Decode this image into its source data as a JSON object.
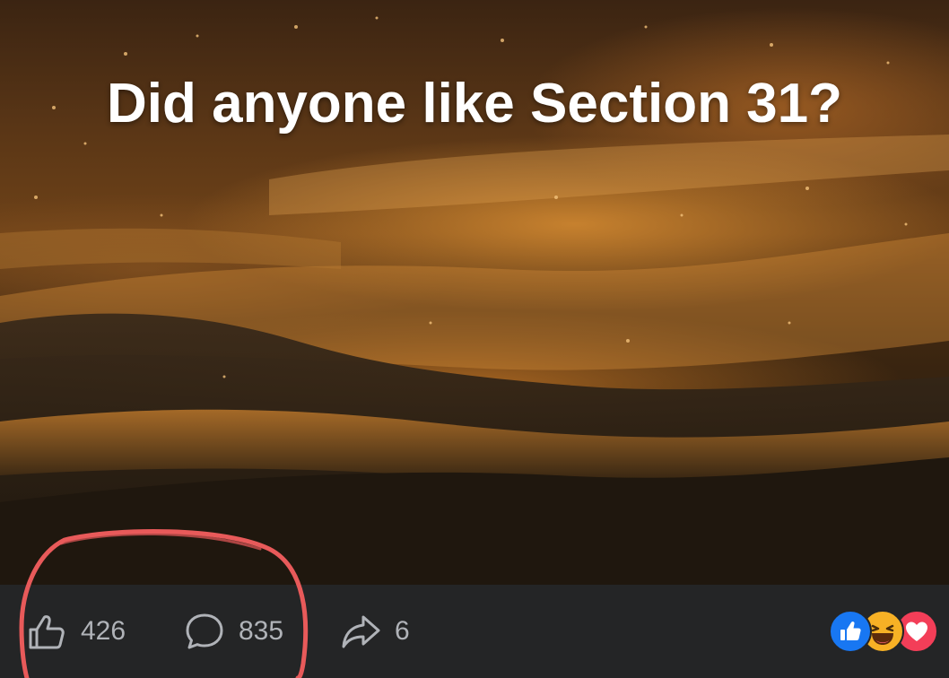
{
  "post": {
    "title": "Did anyone like Section 31?"
  },
  "actions": {
    "like_count": "426",
    "comment_count": "835",
    "share_count": "6"
  },
  "icons": {
    "like": "thumbs-up-icon",
    "comment": "comment-bubble-icon",
    "share": "share-arrow-icon"
  },
  "reactions": [
    "like",
    "haha",
    "love"
  ],
  "colors": {
    "bar_background": "#242526",
    "text_muted": "#b0b3b8",
    "like_blue": "#1877f2",
    "haha_yellow": "#f7b125",
    "love_red": "#f33e58",
    "annotation_red": "#e85a5a"
  }
}
